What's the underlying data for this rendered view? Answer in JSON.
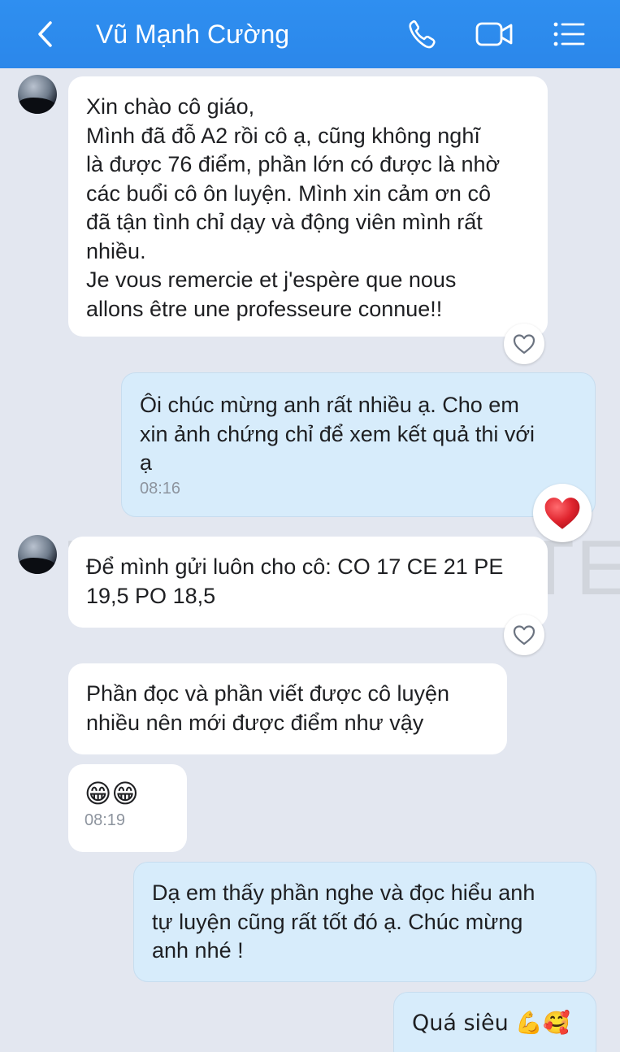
{
  "header": {
    "contact_name": "Vũ Mạnh Cường",
    "icons": [
      "back-arrow-icon",
      "phone-icon",
      "video-call-icon",
      "menu-list-icon"
    ],
    "bg_color": "#2f8ff0"
  },
  "watermark": "Troong TCF-TEF",
  "messages": [
    {
      "side": "in",
      "text": "Xin chào cô giáo,\nMình đã đỗ A2 rồi cô ạ, cũng không nghĩ\nlà được 76 điểm, phần lớn có được là nhờ\ncác buổi cô ôn luyện. Mình xin cảm ơn cô\nđã tận tình chỉ dạy và động viên mình rất\nnhiều.\nJe vous remercie et j'espère que nous\nallons être une professeure connue!!",
      "reaction": "heart-outline-icon"
    },
    {
      "side": "out",
      "text": "Ôi chúc mừng anh rất nhiều ạ. Cho em\nxin ảnh chứng chỉ để xem kết quả thi với\nạ",
      "time": "08:16",
      "reaction": "red-heart-icon"
    },
    {
      "side": "in",
      "text": "Để mình gửi luôn cho cô: CO 17 CE 21 PE\n19,5 PO 18,5",
      "reaction": "heart-outline-icon"
    },
    {
      "side": "in",
      "text": "Phần đọc và phần viết được cô luyện\nnhiều nên mới được điểm như vậy"
    },
    {
      "side": "in",
      "text": "😁😁",
      "time": "08:19"
    },
    {
      "side": "out",
      "text": "Dạ em thấy phần nghe và đọc hiểu anh\ntự luyện cũng rất tốt đó ạ. Chúc mừng\nanh nhé !"
    },
    {
      "side": "out",
      "text": "Quá siêu 💪🥰"
    }
  ],
  "colors": {
    "incoming_bubble": "#ffffff",
    "outgoing_bubble": "#d7ecfb",
    "chat_background": "#e3e7f0",
    "heart_red": "#e0242e"
  }
}
